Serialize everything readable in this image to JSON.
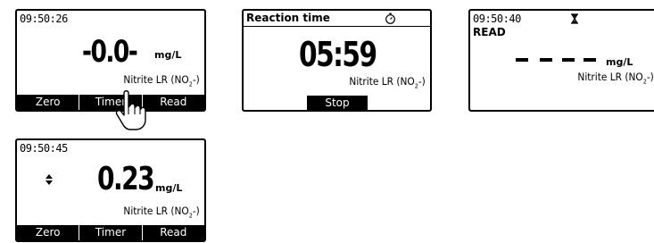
{
  "screen1": {
    "clock": "09:50:26",
    "reading": "-0.0-",
    "unit": "mg/L",
    "parameter": "Nitrite LR (NO",
    "parameter_sub": "2",
    "parameter_end": "-)",
    "softkeys": [
      "Zero",
      "Timer",
      "Read"
    ]
  },
  "screen2": {
    "title": "Reaction time",
    "countdown": "05:59",
    "parameter": "Nitrite LR (NO",
    "parameter_sub": "2",
    "parameter_end": "-)",
    "softkey": "Stop"
  },
  "screen3": {
    "clock": "09:50:40",
    "status": "READ",
    "unit": "mg/L",
    "parameter": "Nitrite LR (NO",
    "parameter_sub": "2",
    "parameter_end": "-)"
  },
  "screen4": {
    "clock": "09:50:45",
    "reading": "0.23",
    "unit": "mg/L",
    "parameter": "Nitrite LR (NO",
    "parameter_sub": "2",
    "parameter_end": "-)",
    "softkeys": [
      "Zero",
      "Timer",
      "Read"
    ]
  },
  "icons": {
    "stopwatch": "stopwatch-icon",
    "hourglass": "hourglass-icon",
    "updown": "up-down-arrows-icon",
    "hand": "pointing-hand-icon"
  }
}
